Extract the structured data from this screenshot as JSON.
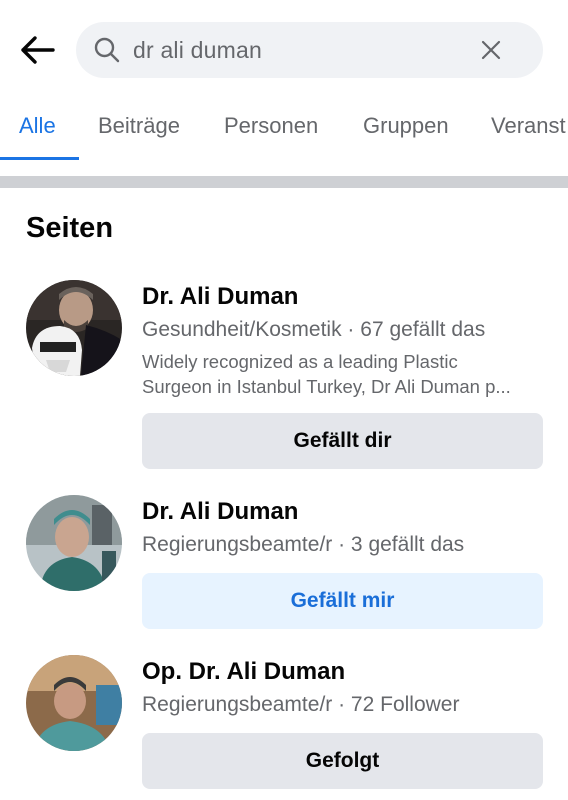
{
  "search": {
    "query": "dr ali duman"
  },
  "tabs": [
    {
      "label": "Alle"
    },
    {
      "label": "Beiträge"
    },
    {
      "label": "Personen"
    },
    {
      "label": "Gruppen"
    },
    {
      "label": "Veranst"
    }
  ],
  "section": {
    "title": "Seiten"
  },
  "results": [
    {
      "name": "Dr. Ali Duman",
      "meta": "Gesundheit/Kosmetik · 67 gefällt das",
      "description_line1": "Widely recognized as a leading Plastic",
      "description_line2": "Surgeon in Istanbul Turkey, Dr Ali Duman p...",
      "button": "Gefällt dir"
    },
    {
      "name": "Dr. Ali Duman",
      "meta": "Regierungsbeamte/r · 3 gefällt das",
      "button": "Gefällt mir"
    },
    {
      "name": "Op. Dr. Ali Duman",
      "meta": "Regierungsbeamte/r · 72 Follower",
      "button": "Gefolgt"
    }
  ],
  "colors": {
    "accent": "#1b74e4",
    "secondary_text": "#65676b",
    "button_gray": "#e4e6eb",
    "button_light_blue": "#e7f3ff",
    "divider": "#ced0d4"
  }
}
